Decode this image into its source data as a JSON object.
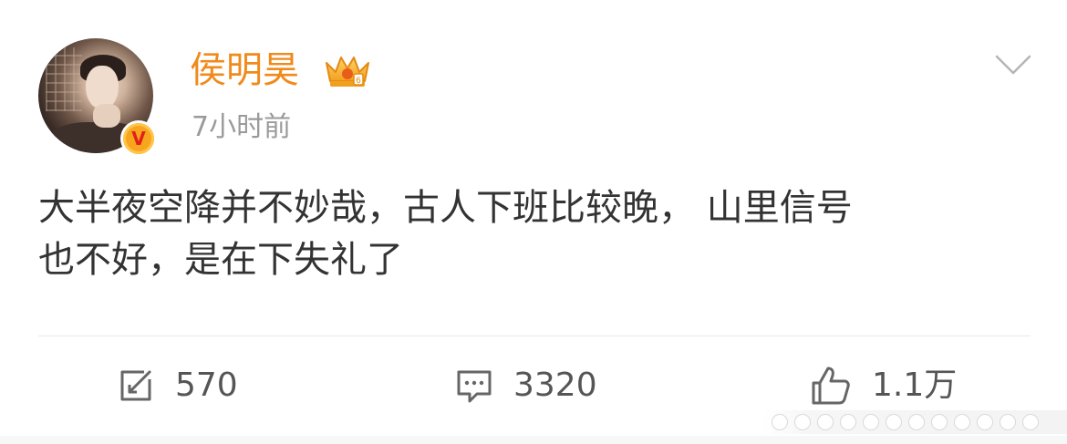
{
  "post": {
    "author": {
      "name": "侯明昊",
      "verified_badge": "V",
      "avatar_icon": "avatar-photo",
      "member_icon": "crown-icon"
    },
    "timestamp": "7小时前",
    "text_line1": "大半夜空降并不妙哉，古人下班比较晚， 山里信号",
    "text_line2": "也不好，是在下失礼了",
    "more_icon": "chevron-down-icon"
  },
  "actions": {
    "repost": {
      "icon": "repost-icon",
      "count": "570"
    },
    "comment": {
      "icon": "comment-icon",
      "count": "3320"
    },
    "like": {
      "icon": "thumbs-up-icon",
      "count": "1.1万"
    }
  },
  "colors": {
    "username": "#f08a1c",
    "timestamp": "#9a9a9a",
    "text": "#333333",
    "verified": "#f7a51e"
  }
}
